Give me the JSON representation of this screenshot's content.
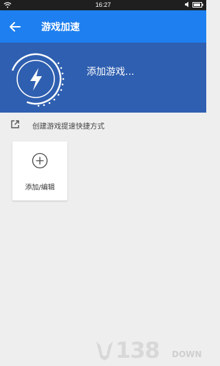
{
  "status_bar": {
    "time": "16:27"
  },
  "app_bar": {
    "title": "游戏加速",
    "back_icon": "arrow-left-icon"
  },
  "hero": {
    "text": "添加游戏...",
    "icon": "lightning-bolt-icon"
  },
  "shortcut": {
    "label": "创建游戏提速快捷方式",
    "icon": "open-external-icon"
  },
  "add_card": {
    "label": "添加/编辑",
    "icon": "plus-circle-icon"
  },
  "watermark": {
    "number": "138",
    "suffix": "DOWN"
  },
  "colors": {
    "app_bar": "#1e7ff0",
    "hero": "#2f5fb0",
    "background": "#eeeeee"
  }
}
